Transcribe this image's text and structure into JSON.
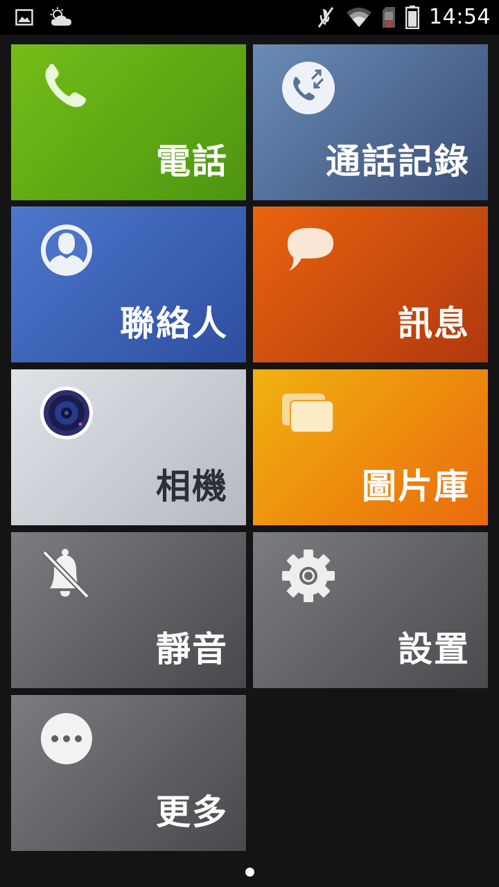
{
  "status_bar": {
    "time": "14:54",
    "left_icons": [
      "image-icon",
      "weather-icon"
    ],
    "right_icons": [
      "mute-icon",
      "wifi-icon",
      "sim-error-icon",
      "battery-icon"
    ]
  },
  "tiles": [
    {
      "id": "phone",
      "label": "電話",
      "icon": "phone-icon"
    },
    {
      "id": "call-log",
      "label": "通話記錄",
      "icon": "call-log-icon"
    },
    {
      "id": "contacts",
      "label": "聯絡人",
      "icon": "contact-icon"
    },
    {
      "id": "messages",
      "label": "訊息",
      "icon": "message-icon"
    },
    {
      "id": "camera",
      "label": "相機",
      "icon": "camera-icon"
    },
    {
      "id": "gallery",
      "label": "圖片庫",
      "icon": "gallery-icon"
    },
    {
      "id": "silent",
      "label": "靜音",
      "icon": "bell-off-icon"
    },
    {
      "id": "settings",
      "label": "設置",
      "icon": "gear-icon"
    },
    {
      "id": "more",
      "label": "更多",
      "icon": "more-icon"
    }
  ],
  "pager": {
    "pages": 1,
    "current": 1
  }
}
